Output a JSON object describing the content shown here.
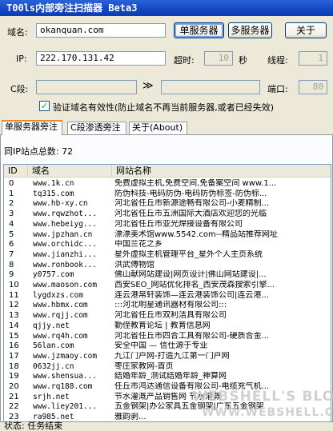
{
  "window": {
    "title": "T00ls内部旁注扫描器 Beta3"
  },
  "domain": {
    "label": "域名:",
    "value": "okanquan.com"
  },
  "buttons": {
    "single": "单服务器",
    "multi": "多服务器",
    "close": "关于"
  },
  "ip": {
    "label": "IP:",
    "value": "222.170.131.42",
    "timeout_label": "超时:",
    "timeout_value": "10",
    "seconds": "秒",
    "threads_label": "线程:",
    "threads_value": "1"
  },
  "cseg": {
    "label": "C段:",
    "arrows": "≫",
    "port_label": "端口:",
    "port_value": "80"
  },
  "verify": {
    "checked": true,
    "label": "验证域名有效性(防止域名不再当前服务器,或者已经失效)"
  },
  "tabs": [
    "单服务器旁注",
    "C段渗透旁注",
    "关于(About)"
  ],
  "summary": {
    "label": "同IP站点总数:",
    "count": "72"
  },
  "table": {
    "headers": [
      "ID",
      "域名",
      "网站名称"
    ],
    "rows": [
      [
        "0",
        "www.1k.cn",
        "免费虚拟主机,免费空间,免备案空间 www.1..."
      ],
      [
        "1",
        "tq315.com",
        "防伪科技-电码防伪-电码防伪标签-防伪标..."
      ],
      [
        "2",
        "www.hb-xy.cn",
        "河北省任丘市新源途畅有限公司-小麦精制..."
      ],
      [
        "3",
        "www.rqwzhot...",
        "河北省任丘市五洲国际大酒店欢迎您的光临"
      ],
      [
        "4",
        "www.hebeiyg...",
        "河北省任丘市亚光焊接设备有限公司"
      ],
      [
        "5",
        "www.jpzhan.cn",
        "漂漂美术馆www.5542.com--精品站推荐网址"
      ],
      [
        "6",
        "www.orchidc...",
        "中国兰花之乡"
      ],
      [
        "7",
        "www.jianzhi...",
        "星外虚拟主机管理平台_星外个人主页系统"
      ],
      [
        "8",
        "www.ronbook...",
        "洪武傅物馆"
      ],
      [
        "9",
        "y0757.com",
        "佛山献网站建设|网页设计|佛山网站建设|..."
      ],
      [
        "10",
        "www.maoson.com",
        "西安SEO_网站优化排名_西安茂森搜索引擎..."
      ],
      [
        "11",
        "lygdxzs.com",
        "连云港帛轩装饰—连云港装饰公司|连云港..."
      ],
      [
        "12",
        "www.hbmx.com",
        ":::河北明星通讯器材有限公司:::"
      ],
      [
        "13",
        "www.rqjj.com",
        "河北省任丘市双利洁具有限公司"
      ],
      [
        "14",
        "qjjy.net",
        "勤侄教育论坛 | 教育信息网"
      ],
      [
        "15",
        "www.rq4h.com",
        "河北省任丘市四合工具有限公司-硬质合金..."
      ],
      [
        "16",
        "56lan.com",
        "安全中国 — 信仕源于专业"
      ],
      [
        "17",
        "www.jzmaoy.com",
        "九江门户网-打造九江第一门户网"
      ],
      [
        "18",
        "0632jj.cn",
        "枣庄家教网-首页"
      ],
      [
        "19",
        "www.shensua...",
        "结婚年龄_测试结婚年龄_神算网"
      ],
      [
        "20",
        "www.rq188.com",
        "任丘市鸿达通信设备有限公司-电缆充气机..."
      ],
      [
        "21",
        "srjh.net",
        "节水灌溉产品销售网 节水灌溉"
      ],
      [
        "22",
        "www.liey201...",
        "五金钢架|办公家具五金钢架|广东五金钢架"
      ],
      [
        "23",
        "ra985.net",
        "雅韵剥..."
      ]
    ]
  },
  "status": {
    "text": "状态: 任务结束"
  },
  "watermark": {
    "blog": "WEBSHELL'S BLOG",
    "url": "WWW.WEBSHELL.CC"
  }
}
